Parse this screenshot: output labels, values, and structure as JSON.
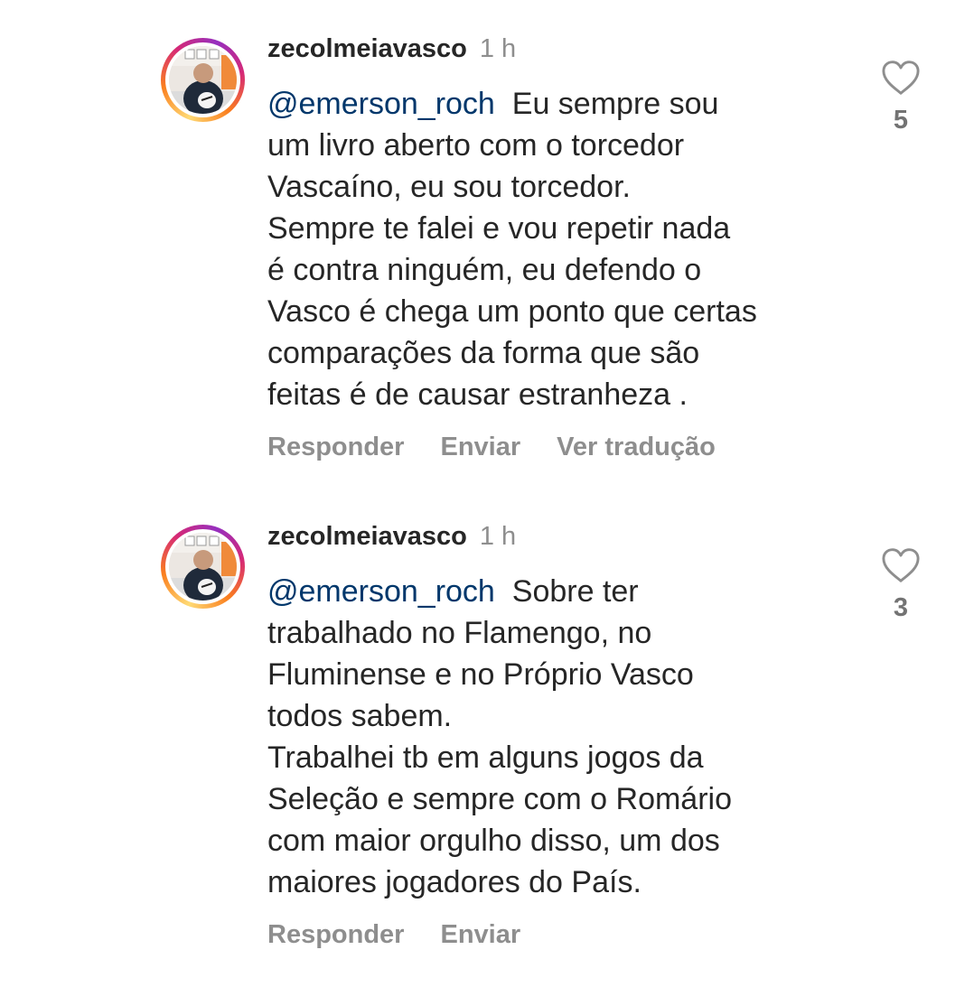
{
  "comments": [
    {
      "username": "zecolmeiavasco",
      "time": "1 h",
      "mention": "@emerson_roch",
      "text": "Eu sempre sou\num livro aberto com o torcedor\nVascaíno, eu sou torcedor.\nSempre te falei e vou repetir nada\né contra ninguém, eu defendo o\nVasco é chega um ponto que certas\ncomparações da forma que são\nfeitas é de causar estranheza .",
      "actions": [
        "Responder",
        "Enviar",
        "Ver tradução"
      ],
      "likes": "5",
      "like_icon": "heart-outline-icon"
    },
    {
      "username": "zecolmeiavasco",
      "time": "1 h",
      "mention": "@emerson_roch",
      "text": "Sobre ter\ntrabalhado no Flamengo, no\nFluminense e no Próprio Vasco\ntodos sabem.\nTrabalhei tb em alguns jogos da\nSeleção e sempre com o Romário\ncom maior orgulho disso, um dos\nmaiores jogadores do País.",
      "actions": [
        "Responder",
        "Enviar"
      ],
      "likes": "3",
      "like_icon": "heart-outline-icon"
    }
  ],
  "colors": {
    "text": "#262626",
    "muted": "#8e8e8e",
    "mention": "#00376b",
    "story_ring": [
      "#feda75",
      "#fa7e1e",
      "#d62976",
      "#962fbf"
    ]
  }
}
